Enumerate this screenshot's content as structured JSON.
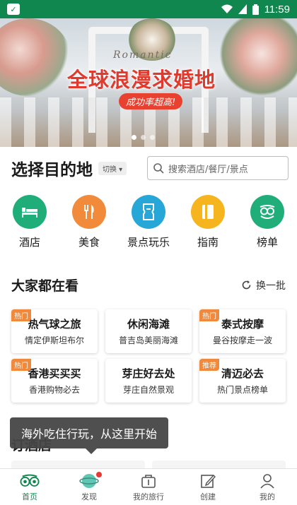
{
  "status_bar": {
    "time": "11:59",
    "app_icon": "tripadvisor-app-icon"
  },
  "banner": {
    "script_text": "Romantic",
    "headline": "全球浪漫求婚地",
    "pill": "成功率超高!",
    "slides": 3,
    "active_slide": 1
  },
  "destination": {
    "title": "选择目的地",
    "switch_label": "切换",
    "search_placeholder": "搜索酒店/餐厅/景点"
  },
  "categories": [
    {
      "label": "酒店",
      "icon": "bed-icon",
      "color": "#1fae7a"
    },
    {
      "label": "美食",
      "icon": "fork-knife-icon",
      "color": "#f28a3c"
    },
    {
      "label": "景点玩乐",
      "icon": "ticket-icon",
      "color": "#27a7d8"
    },
    {
      "label": "指南",
      "icon": "book-icon",
      "color": "#f6b51e"
    },
    {
      "label": "榜单",
      "icon": "award-icon",
      "color": "#1fae7a"
    }
  ],
  "popular": {
    "title": "大家都在看",
    "refresh_label": "换一批",
    "cards": [
      {
        "badge": "热门",
        "title": "热气球之旅",
        "subtitle": "情定伊斯坦布尔"
      },
      {
        "badge": "",
        "title": "休闲海滩",
        "subtitle": "普吉岛美丽海滩"
      },
      {
        "badge": "热门",
        "title": "泰式按摩",
        "subtitle": "曼谷按摩走一波"
      },
      {
        "badge": "热门",
        "title": "香港买买买",
        "subtitle": "香港购物必去"
      },
      {
        "badge": "",
        "title": "芽庄好去处",
        "subtitle": "芽庄自然景观"
      },
      {
        "badge": "推荐",
        "title": "清迈必去",
        "subtitle": "热门景点榜单"
      }
    ]
  },
  "hotels": {
    "title": "订酒店"
  },
  "tooltip": "海外吃住行玩，从这里开始",
  "tabs": [
    {
      "label": "首页",
      "icon": "owl-icon",
      "active": true
    },
    {
      "label": "发现",
      "icon": "planet-icon",
      "active": false
    },
    {
      "label": "我的旅行",
      "icon": "suitcase-icon",
      "active": false
    },
    {
      "label": "创建",
      "icon": "edit-icon",
      "active": false
    },
    {
      "label": "我的",
      "icon": "user-icon",
      "active": false
    }
  ],
  "colors": {
    "brand": "#10874e",
    "badge": "#f0893b",
    "headline": "#e03a2f"
  }
}
